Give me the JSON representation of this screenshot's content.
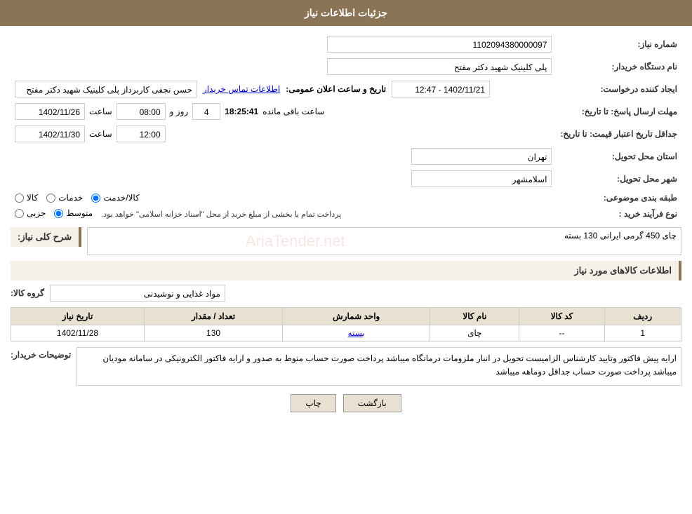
{
  "header": {
    "title": "جزئیات اطلاعات نیاز"
  },
  "fields": {
    "need_number_label": "شماره نیاز:",
    "need_number_value": "1102094380000097",
    "buyer_device_label": "نام دستگاه خریدار:",
    "buyer_device_value": "پلی کلینیک شهید دکتر مفتح",
    "announcement_date_label": "تاریخ و ساعت اعلان عمومی:",
    "announcement_date_value": "1402/11/21 - 12:47",
    "requester_label": "ایجاد کننده درخواست:",
    "requester_value": "حسن نجفی کاربرداز پلی کلینیک شهید دکتر مفتح",
    "contact_info_link": "اطلاعات تماس خریدار",
    "reply_deadline_label": "مهلت ارسال پاسخ: تا تاریخ:",
    "reply_date_value": "1402/11/26",
    "reply_time_label": "ساعت",
    "reply_time_value": "08:00",
    "reply_day_label": "روز و",
    "reply_day_value": "4",
    "remaining_time_value": "18:25:41",
    "remaining_time_label": "ساعت باقی مانده",
    "price_deadline_label": "جداقل تاریخ اعتبار قیمت: تا تاریخ:",
    "price_date_value": "1402/11/30",
    "price_time_label": "ساعت",
    "price_time_value": "12:00",
    "province_label": "استان محل تحویل:",
    "province_value": "تهران",
    "city_label": "شهر محل تحویل:",
    "city_value": "اسلامشهر",
    "category_label": "طبقه بندی موضوعی:",
    "category_kala": "کالا",
    "category_khadamat": "خدمات",
    "category_kala_khadamat": "کالا/خدمت",
    "purchase_type_label": "نوع فرآیند خرید :",
    "purchase_type_jozvi": "جزیی",
    "purchase_type_متوسط": "متوسط",
    "purchase_note": "پرداخت تمام یا بخشی از مبلغ خرید از محل \"اسناد خزانه اسلامی\" خواهد بود.",
    "need_description_label": "شرح کلی نیاز:",
    "need_description_value": "چای 450 گرمی ایرانی 130 بسته",
    "goods_info_label": "اطلاعات کالاهای مورد نیاز",
    "goods_group_label": "گروه کالا:",
    "goods_group_value": "مواد غذایی و نوشیدنی",
    "table_headers": {
      "row": "ردیف",
      "code": "کد کالا",
      "name": "نام کالا",
      "unit": "واحد شمارش",
      "quantity": "تعداد / مقدار",
      "date": "تاریخ نیاز"
    },
    "table_rows": [
      {
        "row": "1",
        "code": "--",
        "name": "چای",
        "unit": "بسته",
        "quantity": "130",
        "date": "1402/11/28"
      }
    ],
    "buyer_notes_label": "توضیحات خریدار:",
    "buyer_notes_value": "ارایه پیش فاکتور وتایید کارشناس الزامیست تحویل در انبار ملزومات درمانگاه  میباشد پرداخت صورت حساب منوط به صدور و ارایه فاکتور الکترونیکی در سامانه مودیان میباشد پرداخت صورت حساب جداقل دوماهه میباشد"
  },
  "buttons": {
    "back_label": "بازگشت",
    "print_label": "چاپ"
  }
}
